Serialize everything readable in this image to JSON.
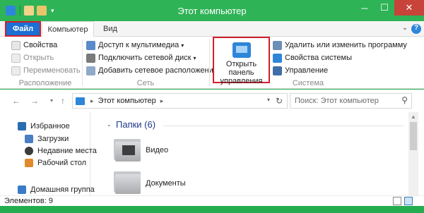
{
  "window": {
    "title": "Этот компьютер",
    "controls": {
      "minimize": "─",
      "maximize": "☐",
      "close": "✕"
    },
    "accent_color": "#2fb357"
  },
  "ribbon_tabs": {
    "file": "Файл",
    "computer": "Компьютер",
    "view": "Вид"
  },
  "ribbon": {
    "location": {
      "items": [
        "Свойства",
        "Открыть",
        "Переименовать"
      ],
      "label": "Расположение"
    },
    "network": {
      "items": [
        "Доступ к мультимедиа",
        "Подключить сетевой диск",
        "Добавить сетевое расположение"
      ],
      "label": "Сеть"
    },
    "control_panel": {
      "line1": "Открыть панель",
      "line2": "управления"
    },
    "system": {
      "items": [
        "Удалить или изменить программу",
        "Свойства системы",
        "Управление"
      ],
      "label": "Система"
    }
  },
  "address": {
    "path": "Этот компьютер",
    "search_placeholder": "Поиск: Этот компьютер"
  },
  "nav_pane": {
    "items": [
      "Избранное",
      "Загрузки",
      "Недавние места",
      "Рабочий стол",
      "Домашняя группа"
    ]
  },
  "content": {
    "section_title": "Папки (6)",
    "folders": [
      "Видео",
      "Документы"
    ]
  },
  "status": {
    "items_count": "Элементов: 9"
  }
}
